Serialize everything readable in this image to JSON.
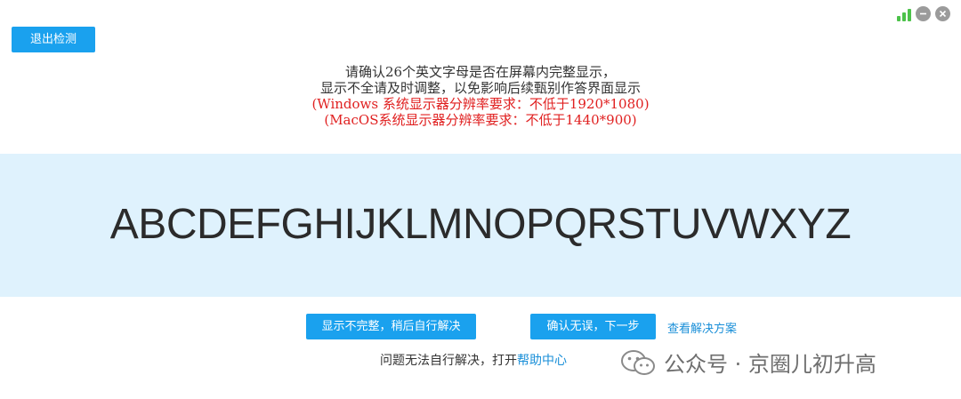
{
  "header": {
    "exit_label": "退出检测"
  },
  "window_controls": {
    "signal_icon": "signal-strength-icon",
    "minimize_icon": "minimize-icon",
    "close_icon": "close-icon"
  },
  "instructions": {
    "line1": "请确认26个英文字母是否在屏幕内完整显示，",
    "line2": "显示不全请及时调整，以免影响后续甄别作答界面显示",
    "line3": "(Windows 系统显示器分辨率要求：不低于1920*1080)",
    "line4": "(MacOS系统显示器分辨率要求：不低于1440*900)"
  },
  "alphabet": "ABCDEFGHIJKLMNOPQRSTUVWXYZ",
  "actions": {
    "incomplete_label": "显示不完整，稍后自行解决",
    "confirm_label": "确认无误，下一步",
    "solution_link": "查看解决方案"
  },
  "help": {
    "prefix": "问题无法自行解决，打开",
    "link": "帮助中心"
  },
  "watermark": {
    "text": "公众号 · 京圈儿初升高",
    "icon": "wechat-icon"
  },
  "colors": {
    "accent": "#1aa1ee",
    "band": "#dff2fd",
    "warning": "#e02020",
    "signal": "#4cc24a"
  }
}
